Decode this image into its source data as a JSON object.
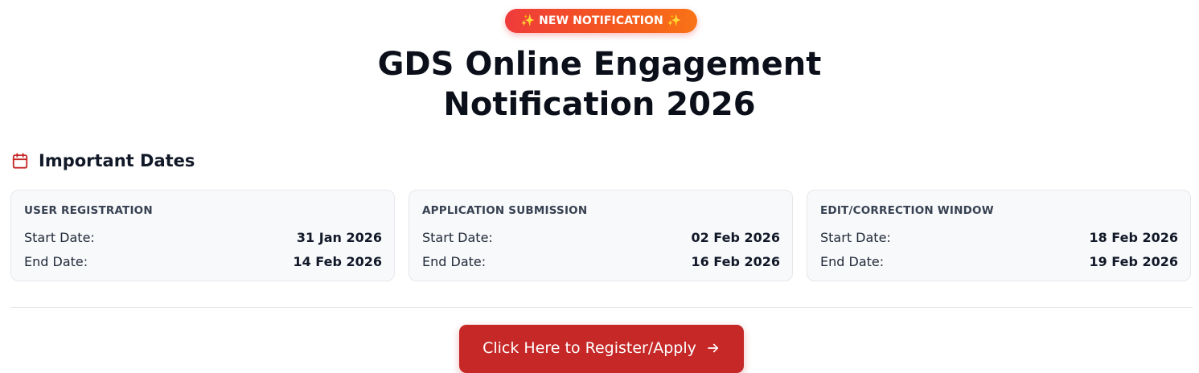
{
  "badge": {
    "text": "✨ NEW NOTIFICATION ✨"
  },
  "title": {
    "line1": "GDS Online Engagement",
    "line2": "Notification 2026"
  },
  "section": {
    "icon": "calendar-icon",
    "heading": "Important Dates"
  },
  "cards": [
    {
      "title": "USER REGISTRATION",
      "start_label": "Start Date:",
      "start_value": "31 Jan 2026",
      "end_label": "End Date:",
      "end_value": "14 Feb 2026"
    },
    {
      "title": "APPLICATION SUBMISSION",
      "start_label": "Start Date:",
      "start_value": "02 Feb 2026",
      "end_label": "End Date:",
      "end_value": "16 Feb 2026"
    },
    {
      "title": "EDIT/CORRECTION WINDOW",
      "start_label": "Start Date:",
      "start_value": "18 Feb 2026",
      "end_label": "End Date:",
      "end_value": "19 Feb 2026"
    }
  ],
  "cta": {
    "label": "Click Here to Register/Apply",
    "icon": "arrow-right-icon"
  },
  "colors": {
    "accent": "#c62828",
    "badge_start": "#ef3b3b",
    "badge_end": "#f97316",
    "icon": "#c62828"
  }
}
